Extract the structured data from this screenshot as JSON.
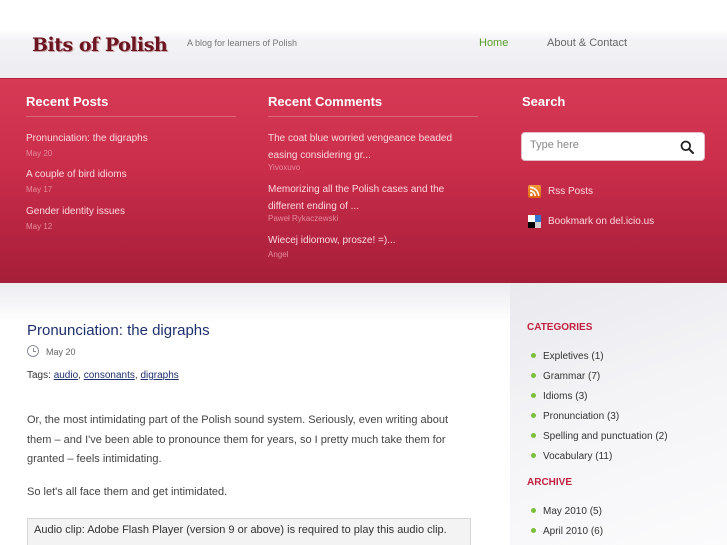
{
  "header": {
    "logo": "Bits of Polish",
    "tagline": "A blog for learners of Polish",
    "nav": {
      "home": "Home",
      "about": "About & Contact"
    }
  },
  "band": {
    "recent_posts": {
      "title": "Recent Posts",
      "items": [
        {
          "title": "Pronunciation: the digraphs",
          "date": "May 20"
        },
        {
          "title": "A couple of bird idioms",
          "date": "May 17"
        },
        {
          "title": "Gender identity issues",
          "date": "May 12"
        }
      ]
    },
    "recent_comments": {
      "title": "Recent Comments",
      "items": [
        {
          "text": "The coat blue worried vengeance beaded easing considering gr...",
          "author": "Yivoxuvo"
        },
        {
          "text": "Memorizing all the Polish cases and the different ending of ...",
          "author": "Paweł Rykaczewski"
        },
        {
          "text": "Wiecej idiomow, prosze! =)...",
          "author": "Angel"
        }
      ]
    },
    "search": {
      "title": "Search",
      "placeholder": "Type here",
      "rss": "Rss Posts",
      "bookmark": "Bookmark on del.icio.us"
    }
  },
  "post": {
    "title": "Pronunciation: the digraphs",
    "date": "May 20",
    "tags_label": "Tags:",
    "tags": [
      "audio",
      "consonants",
      "digraphs"
    ],
    "paragraphs": [
      "Or, the most intimidating part of the Polish sound system. Seriously, even writing about them – and I've been able to pronounce them for years, so I pretty much take them for granted – feels intimidating.",
      "So let's all face them and get intimidated."
    ],
    "audio_notice": "Audio clip: Adobe Flash Player (version 9 or above) is required to play this audio clip."
  },
  "sidebar": {
    "categories_title": "CATEGORIES",
    "categories": [
      {
        "name": "Expletives",
        "count": "(1)"
      },
      {
        "name": "Grammar",
        "count": "(7)"
      },
      {
        "name": "Idioms",
        "count": "(3)"
      },
      {
        "name": "Pronunciation",
        "count": "(3)"
      },
      {
        "name": "Spelling and punctuation",
        "count": "(2)"
      },
      {
        "name": "Vocabulary",
        "count": "(11)"
      }
    ],
    "archive_title": "ARCHIVE",
    "archive": [
      {
        "name": "May 2010",
        "count": "(5)"
      },
      {
        "name": "April 2010",
        "count": "(6)"
      }
    ]
  },
  "colors": {
    "band": "#c92d4a",
    "accent_green": "#5a9e2a",
    "heading_red": "#c1203f",
    "title_blue": "#1e2f6e"
  }
}
